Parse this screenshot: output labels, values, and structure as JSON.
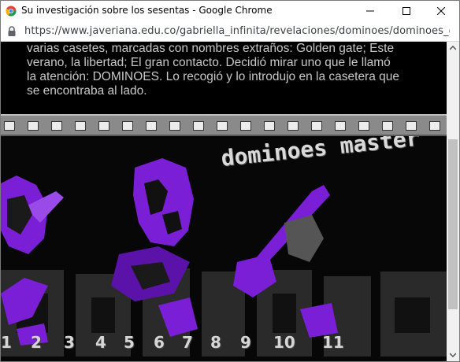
{
  "window": {
    "title": "Su investigación sobre los sesentas - Google Chrome"
  },
  "address_bar": {
    "url": "https://www.javeriana.edu.co/gabriella_infinita/revelaciones/dominoes/dominoes_en..."
  },
  "story": {
    "lines": [
      "varias casetes, marcadas con nombres extraños: Golden gate; Este",
      "verano, la libertad; El gran contacto. Decidió mirar uno que le llamó",
      "la atención: DOMINOES. Lo recogió y lo introdujo en la casetera que",
      "se encontraba al lado."
    ]
  },
  "poster": {
    "brand": "dominoes master",
    "accent_color": "#7b1fd6",
    "track_numbers": [
      "1",
      "2",
      "3",
      "4",
      "5",
      "6",
      "7",
      "8",
      "9",
      "10",
      "11"
    ]
  }
}
